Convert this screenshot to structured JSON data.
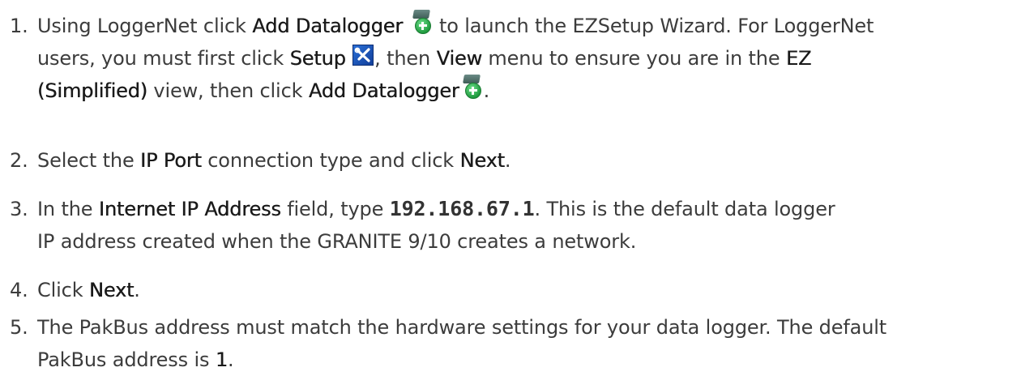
{
  "steps": [
    {
      "number": "1.",
      "t1": "Using LoggerNet click ",
      "b1": "Add Datalogger",
      "t2": " to launch the EZSetup Wizard. For LoggerNet",
      "t3": "users, you must first click ",
      "b2": "Setup",
      "t4": ", then ",
      "b3": "View",
      "t5": " menu to ensure you are in the ",
      "b4": "EZ",
      "b5": "(Simplified)",
      "t6": " view, then click ",
      "b6": "Add Datalogger",
      "t7": "."
    },
    {
      "number": "2.",
      "t1": "Select the ",
      "b1": "IP Port",
      "t2": " connection type and click ",
      "b2": "Next",
      "t3": "."
    },
    {
      "number": "3.",
      "t1": "In the ",
      "b1": "Internet IP Address",
      "t2": " field, type ",
      "code": "192.168.67.1",
      "t3": ". This is the default data logger",
      "t4": "IP address created when the GRANITE 9/10 creates a network."
    },
    {
      "number": "4.",
      "t1": "Click ",
      "b1": "Next",
      "t2": "."
    },
    {
      "number": "5.",
      "t1": "The PakBus address must match the hardware settings for your data logger. The default",
      "t2": "PakBus address is ",
      "b1": "1",
      "t3": "."
    }
  ],
  "icons": {
    "add_datalogger": "add-datalogger-icon",
    "setup": "setup-icon"
  },
  "colors": {
    "text": "#3c3c3c",
    "bold_text": "#1a1a1a",
    "icon_green": "#1f9a3e",
    "icon_blue": "#1f56c4"
  }
}
